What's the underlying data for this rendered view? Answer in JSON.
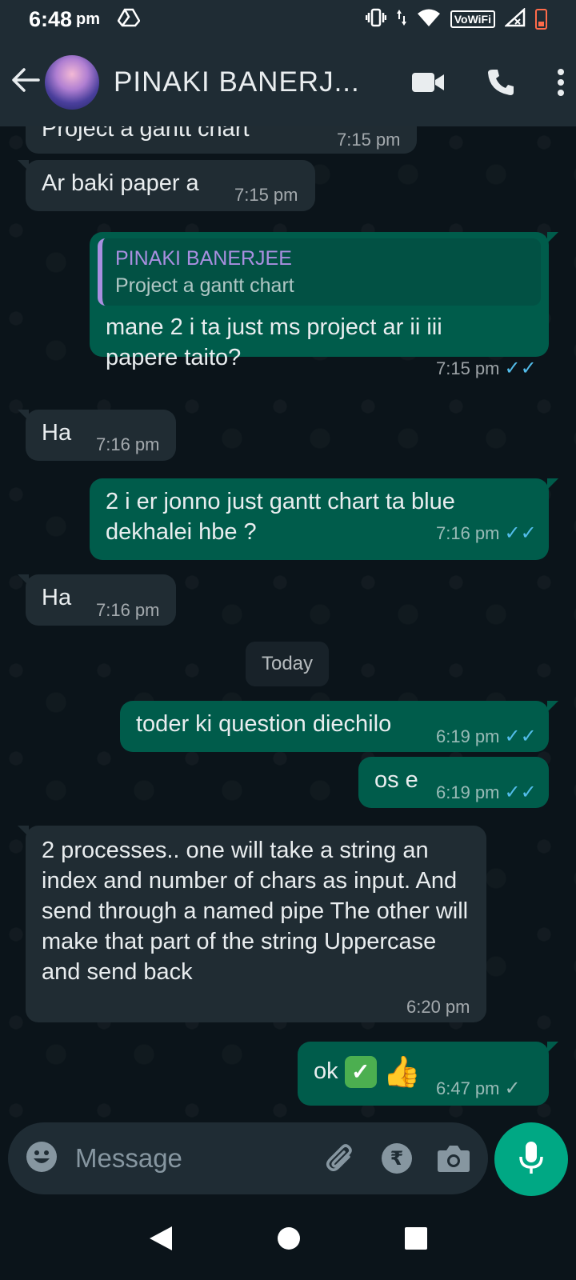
{
  "status_bar": {
    "time": "6:48",
    "ampm": "pm",
    "vowifi": "VoWiFi"
  },
  "header": {
    "contact_name": "PINAKI BANERJ..."
  },
  "messages": [
    {
      "dir": "in",
      "text": "Project a gantt chart",
      "time": "7:15 pm"
    },
    {
      "dir": "in",
      "text": "Ar baki paper a",
      "time": "7:15 pm"
    },
    {
      "dir": "out",
      "quote_name": "PINAKI BANERJEE",
      "quote_text": "Project a gantt chart",
      "text": "mane 2 i ta just ms project ar ii iii papere taito?",
      "time": "7:15 pm",
      "status": "read"
    },
    {
      "dir": "in",
      "text": "Ha",
      "time": "7:16 pm"
    },
    {
      "dir": "out",
      "text": "2 i er jonno just gantt chart ta blue dekhalei hbe ?",
      "time": "7:16 pm",
      "status": "read"
    },
    {
      "dir": "in",
      "text": "Ha",
      "time": "7:16 pm"
    },
    {
      "dir": "out",
      "text": "toder ki question diechilo",
      "time": "6:19 pm",
      "status": "read"
    },
    {
      "dir": "out",
      "text": "os e",
      "time": "6:19 pm",
      "status": "read"
    },
    {
      "dir": "in",
      "text": "2 processes.. one will take a string an index and number of chars as input. And send through a named pipe The other will make that part of the string Uppercase and send back",
      "time": "6:20 pm"
    },
    {
      "dir": "out",
      "text": "ok",
      "time": "6:47 pm",
      "status": "sent"
    }
  ],
  "date_divider": "Today",
  "composer": {
    "placeholder": "Message"
  },
  "colors": {
    "header_bg": "#1f2c34",
    "chat_bg": "#0b141a",
    "incoming_bubble": "#202c33",
    "outgoing_bubble": "#005c4b",
    "accent": "#00a884",
    "read_tick": "#53bdeb"
  }
}
